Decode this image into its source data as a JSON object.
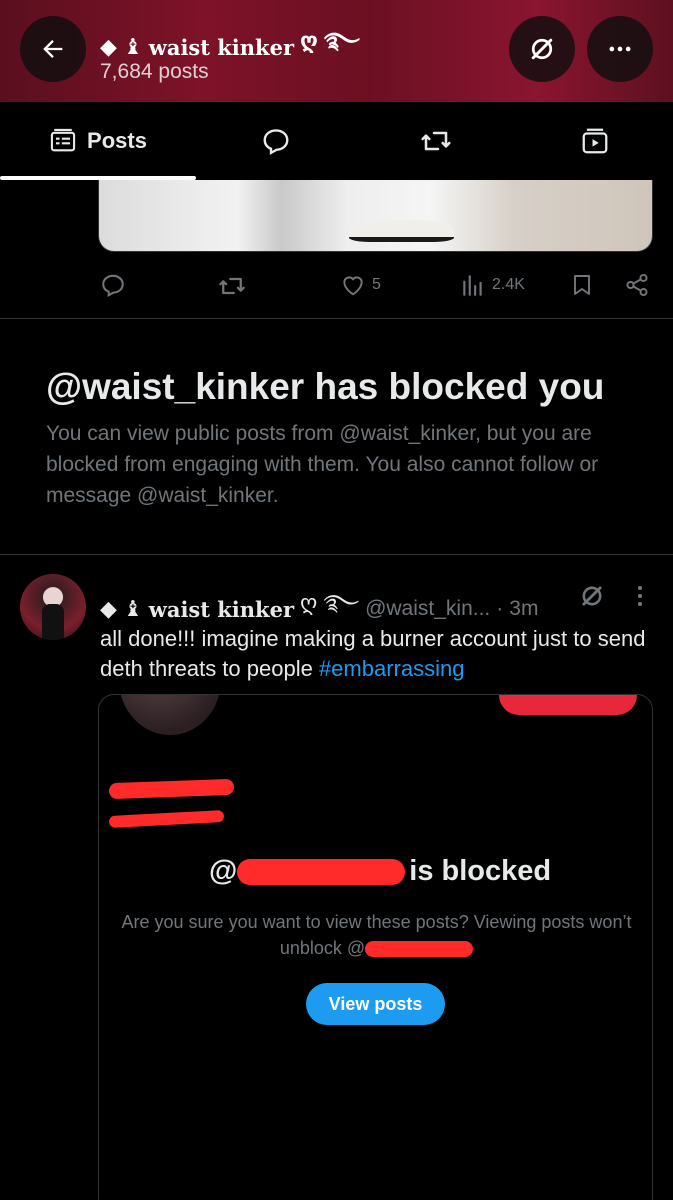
{
  "header": {
    "decor_prefix": "◆ ♝",
    "name": "waist kinker",
    "decor_suffix": "ღ ࿐",
    "post_count": "7,684 posts"
  },
  "tabs": [
    {
      "label": "Posts",
      "icon": "posts-icon",
      "selected": true
    },
    {
      "label": "",
      "icon": "replies-icon"
    },
    {
      "label": "",
      "icon": "reposts-icon"
    },
    {
      "label": "",
      "icon": "media-icon"
    }
  ],
  "prev_post": {
    "likes": "5",
    "views": "2.4K"
  },
  "blocked_notice": {
    "title": "@waist_kinker has blocked you",
    "description": "You can view public posts from @waist_kinker, but you are blocked from engaging with them. You also cannot follow or message @waist_kinker."
  },
  "post": {
    "decor_prefix": "◆ ♝",
    "name": "waist kinker",
    "decor_suffix": "ღ ࿐",
    "handle": "@waist_kin...",
    "dot": "·",
    "time": "3m",
    "text": "all done!!! imagine making a burner account just to send deth threats to people ",
    "hashtag": "#embarrassing"
  },
  "embedded": {
    "blocked_prefix": "@",
    "blocked_suffix": "is blocked",
    "description": "Are you sure you want to view these posts? Viewing posts won’t unblock @",
    "button": "View posts"
  },
  "colors": {
    "accent": "#1d9bf0",
    "header_bg": "#7e1228",
    "muted": "#71767b",
    "redaction": "#ff2b2b"
  }
}
